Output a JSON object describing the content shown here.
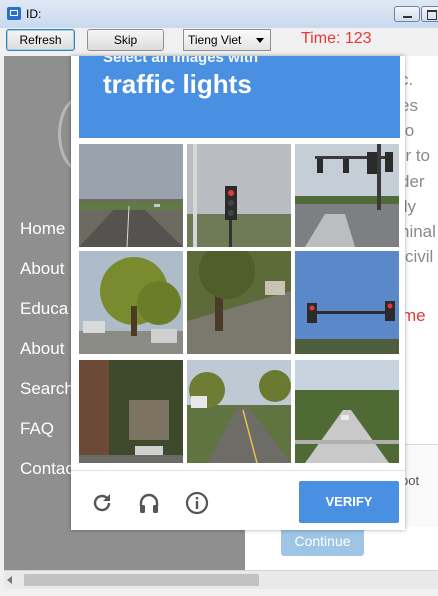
{
  "window": {
    "title": "ID:"
  },
  "toolbar": {
    "refresh_label": "Refresh",
    "skip_label": "Skip",
    "language": "Tieng Viet",
    "timer": "Time: 123"
  },
  "sidebar": {
    "items": [
      {
        "label": "Home"
      },
      {
        "label": "About"
      },
      {
        "label": "Educa"
      },
      {
        "label": "About"
      },
      {
        "label": "Search"
      },
      {
        "label": "FAQ"
      },
      {
        "label": "Contac"
      }
    ]
  },
  "background_text": {
    "lines": [
      "c.",
      "es",
      "to",
      "or to",
      "der",
      "ily",
      "ninal",
      "civil",
      "me"
    ],
    "bot_text": "pot",
    "continue_label": "Continue"
  },
  "captcha": {
    "intro": "Select all images with",
    "target": "traffic lights",
    "tiles": [
      {
        "scene": "highway"
      },
      {
        "scene": "traffic-light-closeup"
      },
      {
        "scene": "intersection-signals"
      },
      {
        "scene": "tree-parking-lot"
      },
      {
        "scene": "tree-driveway"
      },
      {
        "scene": "traffic-light-sky"
      },
      {
        "scene": "brick-building-driveway"
      },
      {
        "scene": "suburban-road"
      },
      {
        "scene": "bridge-road"
      }
    ],
    "verify_label": "VERIFY",
    "accent_color": "#4a90e2"
  }
}
